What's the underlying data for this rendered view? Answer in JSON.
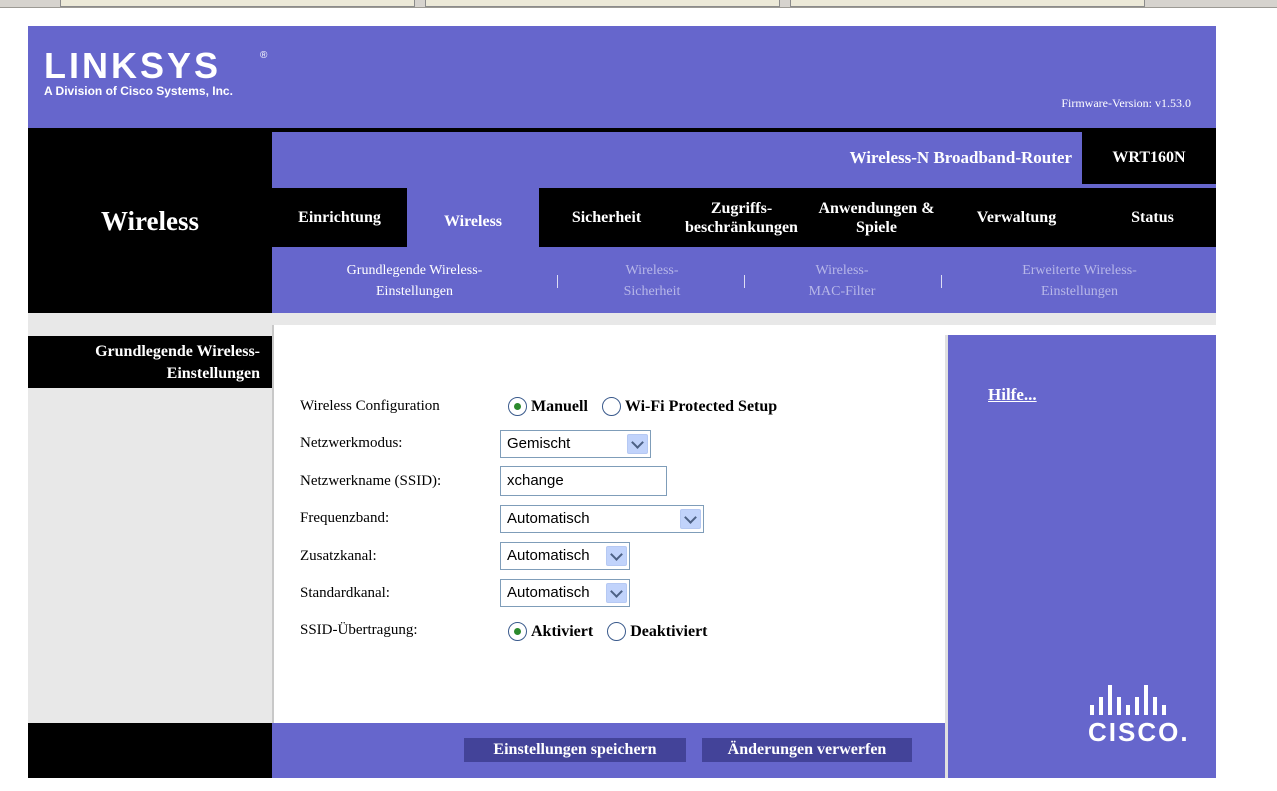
{
  "brand": {
    "logo": "LINKSYS",
    "registered": "®",
    "subtitle": "A Division of Cisco Systems, Inc.",
    "firmware": "Firmware-Version: v1.53.0"
  },
  "product": {
    "name": "Wireless-N Broadband-Router",
    "model": "WRT160N"
  },
  "section_title": "Wireless",
  "tabs": [
    {
      "label": "Einrichtung"
    },
    {
      "label": "Wireless"
    },
    {
      "label": "Sicherheit"
    },
    {
      "label": "Zugriffs- beschränkungen"
    },
    {
      "label": "Anwendungen & Spiele"
    },
    {
      "label": "Verwaltung"
    },
    {
      "label": "Status"
    }
  ],
  "subnav": [
    {
      "line1": "Grundlegende Wireless-",
      "line2": "Einstellungen"
    },
    {
      "line1": "Wireless-",
      "line2": "Sicherheit"
    },
    {
      "line1": "Wireless-",
      "line2": "MAC-Filter"
    },
    {
      "line1": "Erweiterte Wireless-",
      "line2": "Einstellungen"
    }
  ],
  "subnav_separator": "|",
  "left_panel": {
    "title_line1": "Grundlegende Wireless-",
    "title_line2": "Einstellungen"
  },
  "form": {
    "config": {
      "label": "Wireless Configuration",
      "option_manual": "Manuell",
      "option_wps": "Wi-Fi Protected Setup",
      "selected": "Manuell"
    },
    "mode": {
      "label": "Netzwerkmodus:",
      "value": "Gemischt"
    },
    "ssid": {
      "label": "Netzwerkname (SSID):",
      "value": "xchange"
    },
    "band": {
      "label": "Frequenzband:",
      "value": "Automatisch"
    },
    "ext_channel": {
      "label": "Zusatzkanal:",
      "value": "Automatisch"
    },
    "std_channel": {
      "label": "Standardkanal:",
      "value": "Automatisch"
    },
    "broadcast": {
      "label": "SSID-Übertragung:",
      "option_on": "Aktiviert",
      "option_off": "Deaktiviert",
      "selected": "Aktiviert"
    }
  },
  "buttons": {
    "save": "Einstellungen speichern",
    "cancel": "Änderungen verwerfen"
  },
  "help": {
    "link": "Hilfe..."
  },
  "cisco": {
    "word": "CISCO."
  },
  "colors": {
    "brand_purple": "#6666cc",
    "button_dark": "#434399",
    "black": "#000000"
  }
}
